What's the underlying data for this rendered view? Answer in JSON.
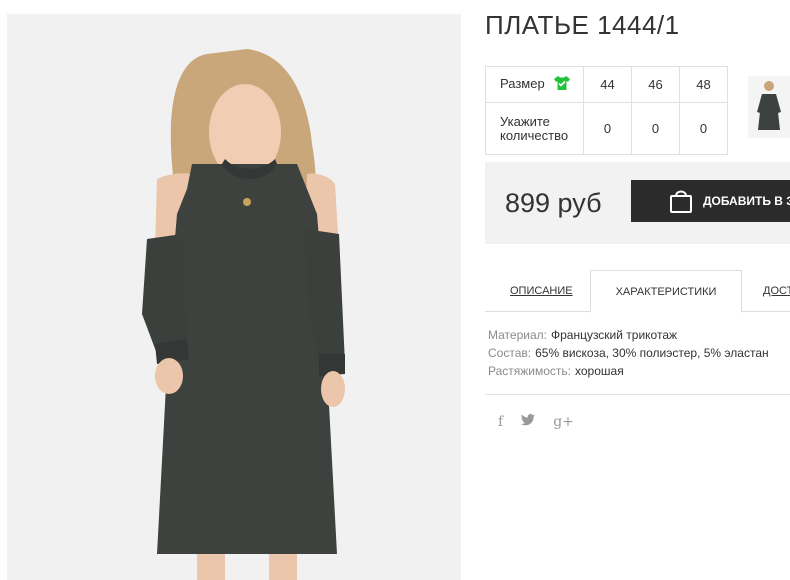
{
  "product": {
    "title": "ПЛАТЬЕ 1444/1",
    "price": "899 руб",
    "add_to_cart_label": "ДОБАВИТЬ В ЗА"
  },
  "sizes": {
    "size_label": "Размер",
    "qty_label_line1": "Укажите",
    "qty_label_line2": "количество",
    "values": [
      "44",
      "46",
      "48"
    ],
    "quantities": [
      "0",
      "0",
      "0"
    ]
  },
  "tabs": [
    "ОПИСАНИЕ",
    "ХАРАКТЕРИСТИКИ",
    "ДОСТ"
  ],
  "characteristics": [
    {
      "key": "Материал:",
      "value": "Французский трикотаж"
    },
    {
      "key": "Состав:",
      "value": "65% вискоза, 30% полиэстер, 5% эластан"
    },
    {
      "key": "Растяжимость:",
      "value": "хорошая"
    }
  ],
  "social": {
    "facebook": "f",
    "twitter": "𝕥",
    "googleplus": "g+"
  },
  "colors": {
    "accent_green": "#22c33a",
    "button_dark": "#2b2b2b",
    "dress": "#3d423f"
  },
  "icons": [
    "tshirt-check-icon",
    "shopping-bag-icon",
    "facebook-icon",
    "twitter-icon",
    "google-plus-icon"
  ]
}
